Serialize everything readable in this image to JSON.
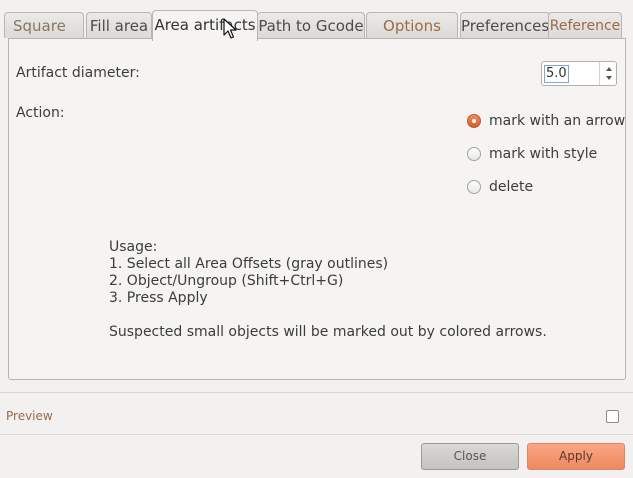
{
  "tabs": [
    {
      "label": "Square",
      "active": false
    },
    {
      "label": "Fill area",
      "active": false
    },
    {
      "label": "Area artifacts",
      "active": true
    },
    {
      "label": "Path to Gcode",
      "active": false
    },
    {
      "label": "Options",
      "active": false
    },
    {
      "label": "Preferences",
      "active": false
    },
    {
      "label": "Reference",
      "active": false
    }
  ],
  "panel": {
    "diameter_label": "Artifact diameter:",
    "diameter_value": "5.0",
    "action_label": "Action:",
    "radios": [
      {
        "label": "mark with an arrow",
        "checked": true
      },
      {
        "label": "mark with style",
        "checked": false
      },
      {
        "label": "delete",
        "checked": false
      }
    ],
    "usage_lines": [
      "Usage:",
      "1. Select all Area Offsets (gray outlines)",
      "2. Object/Ungroup (Shift+Ctrl+G)",
      "3. Press Apply"
    ],
    "usage_note": "Suspected small objects will be marked out by colored arrows."
  },
  "preview": {
    "label": "Preview",
    "checked": false
  },
  "buttons": {
    "close_label": "Close",
    "apply_label": "Apply"
  },
  "colors": {
    "accent": "#ee8860",
    "radio_checked": "#d4602f",
    "preview_text": "#9a6a4a"
  }
}
